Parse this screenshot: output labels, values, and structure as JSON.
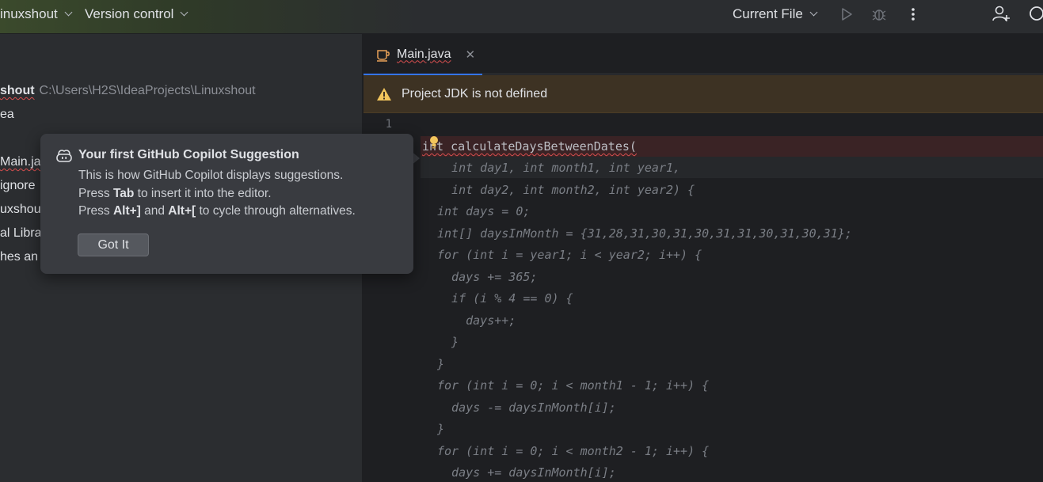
{
  "titlebar": {
    "project_name": "inuxshout",
    "vcs": "Version control",
    "run_config": "Current File"
  },
  "project_panel": {
    "root_name": "shout",
    "root_path": "C:\\Users\\H2S\\IdeaProjects\\Linuxshout",
    "rows": [
      "ea",
      "Main.ja",
      "ignore",
      "uxshou",
      "al Libra",
      "hes an"
    ]
  },
  "editor": {
    "tab_label": "Main.java",
    "banner_text": "Project JDK is not defined",
    "line_number": "1",
    "code_lines": [
      "int calculateDaysBetweenDates(",
      "  int day1, int month1, int year1,",
      "  int day2, int month2, int year2) {",
      "int days = 0;",
      "int[] daysInMonth = {31,28,31,30,31,30,31,31,30,31,30,31};",
      "for (int i = year1; i < year2; i++) {",
      "  days += 365;",
      "  if (i % 4 == 0) {",
      "    days++;",
      "  }",
      "}",
      "for (int i = 0; i < month1 - 1; i++) {",
      "  days -= daysInMonth[i];",
      "}",
      "for (int i = 0; i < month2 - 1; i++) {",
      "  days += daysInMonth[i];"
    ]
  },
  "copilot_popup": {
    "title": "Your first GitHub Copilot Suggestion",
    "line1": "This is how GitHub Copilot displays suggestions.",
    "line2_pre": "Press ",
    "line2_key": "Tab",
    "line2_post": " to insert it into the editor.",
    "line3_pre": "Press ",
    "line3_key1": "Alt+]",
    "line3_mid": " and ",
    "line3_key2": "Alt+[",
    "line3_post": " to cycle through alternatives.",
    "button": "Got It"
  },
  "colors": {
    "accent": "#3574f0",
    "warning_banner": "#3d3223",
    "error_line": "#3a2325"
  }
}
